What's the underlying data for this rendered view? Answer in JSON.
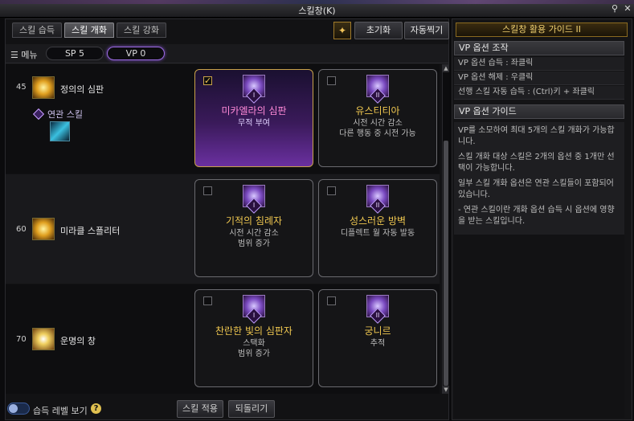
{
  "window": {
    "title": "스킬창(K)",
    "pin_icon": "pin-icon",
    "close_icon": "close-icon"
  },
  "tabs": [
    {
      "label": "스킬 습득",
      "active": false
    },
    {
      "label": "스킬 개화",
      "active": true
    },
    {
      "label": "스킬 강화",
      "active": false
    }
  ],
  "toolbar": {
    "reset_label": "초기화",
    "auto_label": "자동찍기",
    "special_icon": "awakening-icon"
  },
  "menubar": {
    "menu_label": "메뉴",
    "sp": "SP 5",
    "vp": "VP 0"
  },
  "skills": [
    {
      "level": "45",
      "name": "정의의 심판",
      "related_label": "연관 스킬",
      "options": [
        {
          "numeral": "I",
          "name": "미카엘라의 심판",
          "desc1": "무적 부여",
          "desc2": "",
          "checked": true
        },
        {
          "numeral": "II",
          "name": "유스티티아",
          "desc1": "시전 시간 감소",
          "desc2": "다른 행동 중 시전 가능",
          "checked": false
        }
      ]
    },
    {
      "level": "60",
      "name": "미라클 스플리터",
      "options": [
        {
          "numeral": "I",
          "name": "기적의 침례자",
          "desc1": "시전 시간 감소",
          "desc2": "범위 증가",
          "checked": false
        },
        {
          "numeral": "II",
          "name": "성스러운 방벽",
          "desc1": "디플렉트 월 자동 발동",
          "desc2": "",
          "checked": false
        }
      ]
    },
    {
      "level": "70",
      "name": "운명의 창",
      "options": [
        {
          "numeral": "I",
          "name": "찬란한 빛의 심판자",
          "desc1": "스택화",
          "desc2": "범위 증가",
          "checked": false
        },
        {
          "numeral": "II",
          "name": "궁니르",
          "desc1": "추적",
          "desc2": "",
          "checked": false
        }
      ]
    }
  ],
  "bottom": {
    "toggle_label": "습득 레벨 보기",
    "apply_label": "스킬 적용",
    "revert_label": "되돌리기"
  },
  "guide": {
    "header": "스킬창 활용 가이드 II",
    "section1_title": "VP 옵션 조작",
    "lines": [
      "VP 옵션 습득 : 좌클릭",
      "VP 옵션 해제 : 우클릭",
      "선행 스킬 자동 습득 : (Ctrl)키 + 좌클릭"
    ],
    "section2_title": "VP 옵션 가이드",
    "paragraphs": [
      "VP를 소모하여 최대 5개의 스킬 개화가 가능합니다.",
      "스킬 개화 대상 스킬은 2개의 옵션 중 1개만 선택이 가능합니다.",
      "일부 스킬 개화 옵션은 연관 스킬들이 포함되어 있습니다.",
      "- 연관 스킬이란 개화 옵션 습득 시 옵션에 영향을 받는 스킬입니다."
    ]
  }
}
